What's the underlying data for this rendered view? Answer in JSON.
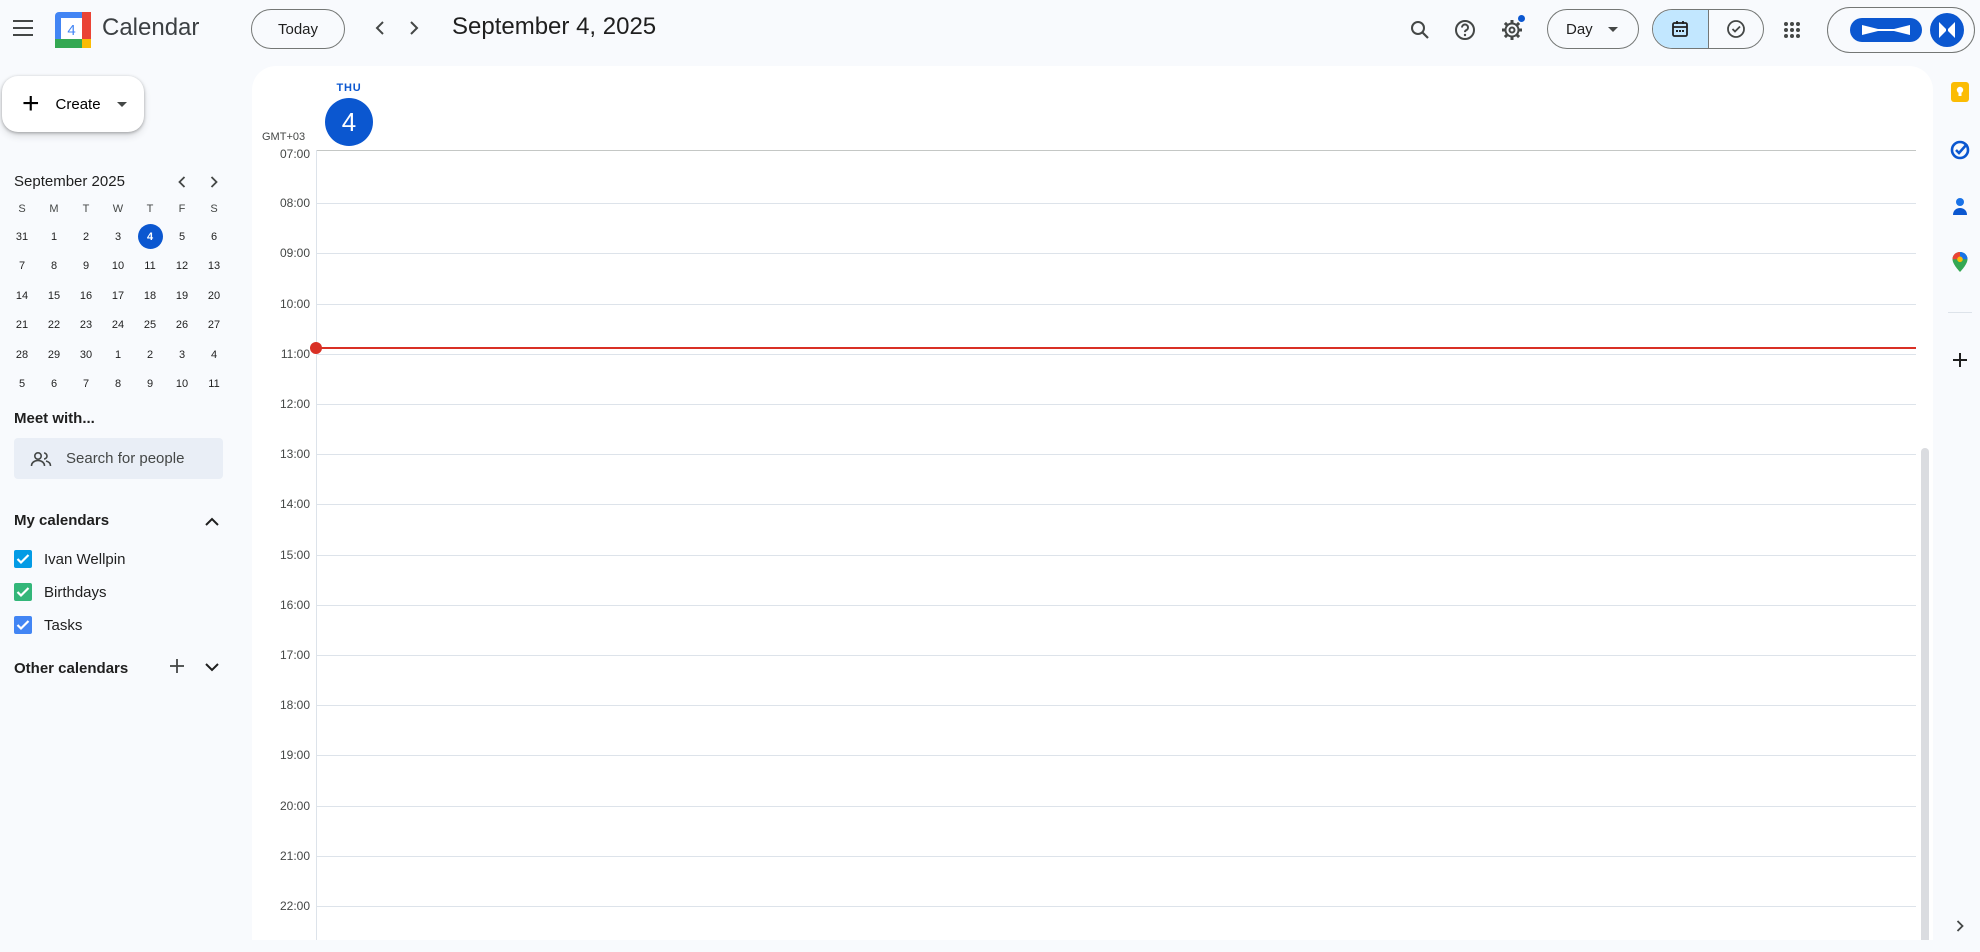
{
  "app": {
    "title": "Calendar",
    "logo_day": "4"
  },
  "header": {
    "today_label": "Today",
    "date_title": "September 4, 2025",
    "view_label": "Day"
  },
  "sidebar": {
    "create_label": "Create",
    "mini_calendar": {
      "month_label": "September 2025",
      "weekdays": [
        "S",
        "M",
        "T",
        "W",
        "T",
        "F",
        "S"
      ],
      "weeks": [
        [
          "31",
          "1",
          "2",
          "3",
          "4",
          "5",
          "6"
        ],
        [
          "7",
          "8",
          "9",
          "10",
          "11",
          "12",
          "13"
        ],
        [
          "14",
          "15",
          "16",
          "17",
          "18",
          "19",
          "20"
        ],
        [
          "21",
          "22",
          "23",
          "24",
          "25",
          "26",
          "27"
        ],
        [
          "28",
          "29",
          "30",
          "1",
          "2",
          "3",
          "4"
        ],
        [
          "5",
          "6",
          "7",
          "8",
          "9",
          "10",
          "11"
        ]
      ],
      "today": "4"
    },
    "meet_with": {
      "title": "Meet with...",
      "placeholder": "Search for people"
    },
    "my_calendars": {
      "title": "My calendars",
      "items": [
        {
          "label": "Ivan Wellpin",
          "color": "#039be5"
        },
        {
          "label": "Birthdays",
          "color": "#33b679"
        },
        {
          "label": "Tasks",
          "color": "#4285f4"
        }
      ]
    },
    "other_calendars": {
      "title": "Other calendars"
    }
  },
  "day_view": {
    "weekday": "THU",
    "day_number": "4",
    "timezone": "GMT+03",
    "hours": [
      "07:00",
      "08:00",
      "09:00",
      "10:00",
      "11:00",
      "12:00",
      "13:00",
      "14:00",
      "15:00",
      "16:00",
      "17:00",
      "18:00",
      "19:00",
      "20:00",
      "21:00",
      "22:00"
    ]
  },
  "colors": {
    "accent": "#0b57d0",
    "now_indicator": "#d93025",
    "selected_view": "#c2e7ff"
  }
}
